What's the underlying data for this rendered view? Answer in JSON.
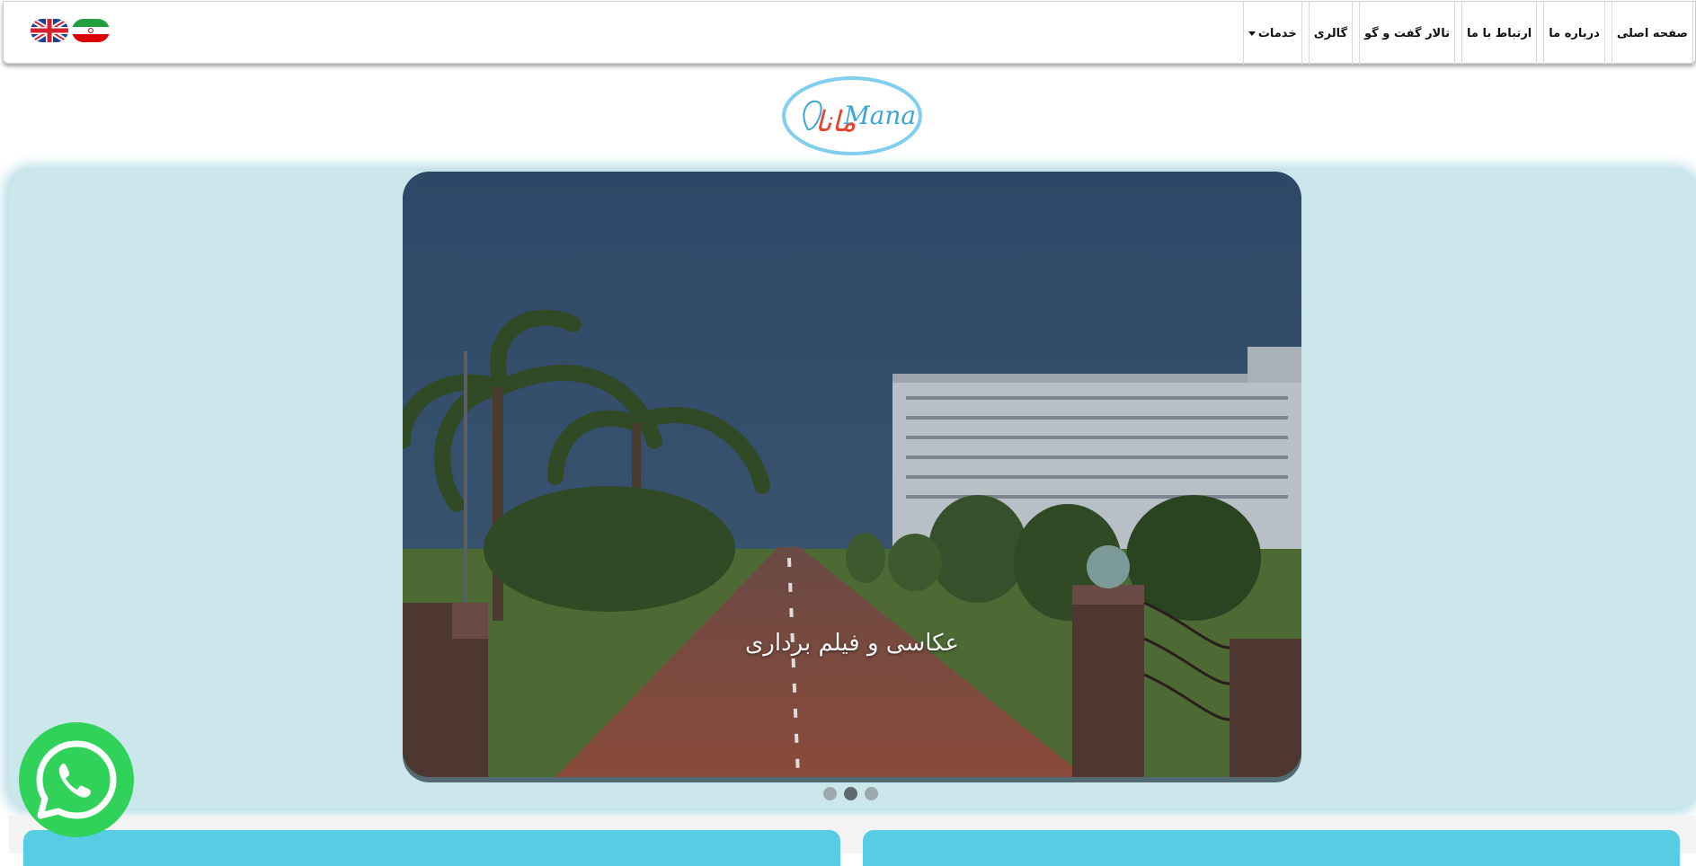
{
  "nav": {
    "items": [
      {
        "label": "صفحه اصلی"
      },
      {
        "label": "درباره ما"
      },
      {
        "label": "ارتباط با ما"
      },
      {
        "label": "تالار گفت و گو"
      },
      {
        "label": "گالری"
      },
      {
        "label": "خدمات",
        "has_dropdown": true
      }
    ],
    "languages": [
      {
        "name": "english-flag-icon",
        "title": "English"
      },
      {
        "name": "iran-flag-icon",
        "title": "فارسی"
      }
    ]
  },
  "logo": {
    "persian_text": "مانا",
    "latin_text": "Mana"
  },
  "slider": {
    "caption": "عکاسی و فیلم برداری",
    "total_slides": 3,
    "active_slide": 2
  },
  "colors": {
    "hero_panel": "#cbe7ec",
    "card": "#56cde3",
    "whatsapp": "#30d25a",
    "logo_ring": "#80cfee"
  },
  "icons": {
    "whatsapp": "whatsapp-icon",
    "dropdown": "caret-down-icon"
  }
}
